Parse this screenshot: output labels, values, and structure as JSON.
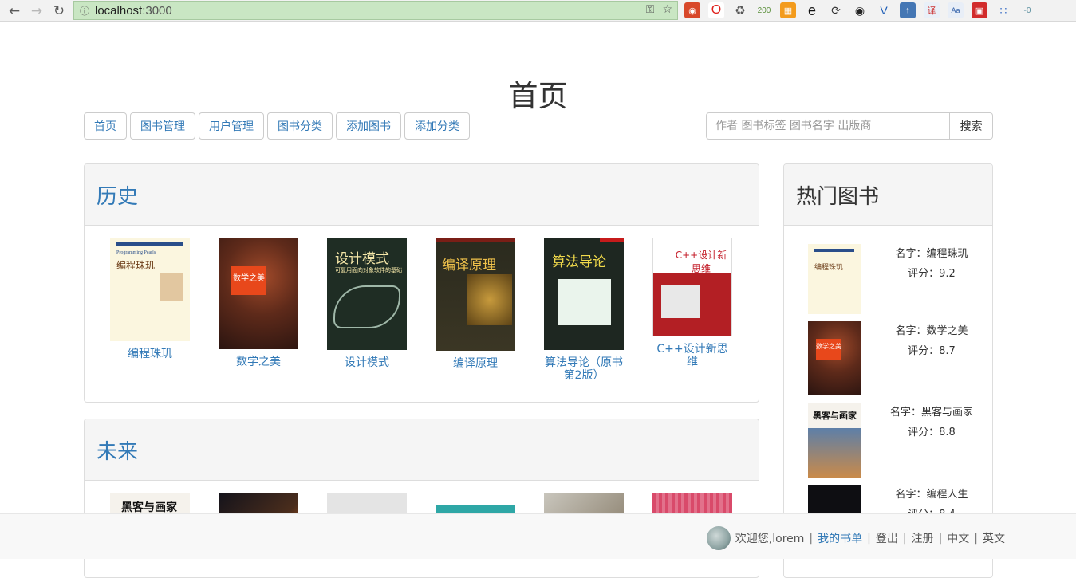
{
  "browser": {
    "url_host": "localhost",
    "url_port": ":3000",
    "ext_badge": "200"
  },
  "page": {
    "title": "首页"
  },
  "nav": {
    "items": [
      "首页",
      "图书管理",
      "用户管理",
      "图书分类",
      "添加图书",
      "添加分类"
    ]
  },
  "search": {
    "placeholder": "作者 图书标签 图书名字 出版商",
    "button": "搜索"
  },
  "categories": [
    {
      "title": "历史",
      "books": [
        {
          "name": "编程珠玑",
          "cover": "c-zhuji"
        },
        {
          "name": "数学之美",
          "cover": "c-shuxue"
        },
        {
          "name": "设计模式",
          "cover": "c-sheji"
        },
        {
          "name": "编译原理",
          "cover": "c-bianyi"
        },
        {
          "name": "算法导论（原书第2版）",
          "cover": "c-suanfa"
        },
        {
          "name": "C++设计新思维",
          "cover": "c-cpp"
        }
      ]
    },
    {
      "title": "未来",
      "books": [
        {
          "name": "",
          "cover": "c-heike"
        },
        {
          "name": "",
          "cover": "c-dark1"
        },
        {
          "name": "",
          "cover": "c-gray"
        },
        {
          "name": "",
          "cover": "c-teal"
        },
        {
          "name": "",
          "cover": "c-photo"
        },
        {
          "name": "",
          "cover": "c-pink"
        }
      ]
    }
  ],
  "hot": {
    "title": "热门图书",
    "items": [
      {
        "name": "名字：编程珠玑",
        "score": "评分：9.2",
        "cover": "c-zhuji"
      },
      {
        "name": "名字：数学之美",
        "score": "评分：8.7",
        "cover": "c-shuxue"
      },
      {
        "name": "名字：黑客与画家",
        "score": "评分：8.8",
        "cover": "c-heike"
      },
      {
        "name": "名字：编程人生",
        "score": "评分：8.4",
        "cover": "c-dark1"
      }
    ]
  },
  "footer": {
    "welcome": "欢迎您,lorem",
    "my_books": "我的书单",
    "logout": "登出",
    "register": "注册",
    "lang_zh": "中文",
    "lang_en": "英文"
  }
}
